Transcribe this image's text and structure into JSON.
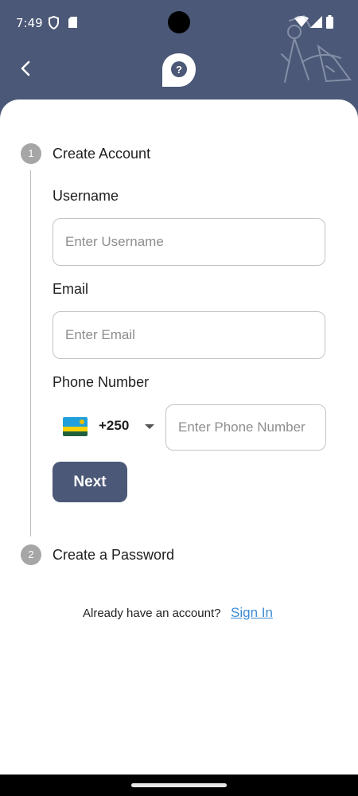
{
  "status_bar": {
    "time": "7:49"
  },
  "steps": [
    {
      "number": "1",
      "title": "Create Account"
    },
    {
      "number": "2",
      "title": "Create a Password"
    }
  ],
  "form": {
    "username": {
      "label": "Username",
      "placeholder": "Enter Username",
      "value": ""
    },
    "email": {
      "label": "Email",
      "placeholder": "Enter Email",
      "value": ""
    },
    "phone": {
      "label": "Phone Number",
      "country_code": "+250",
      "placeholder": "Enter Phone Number",
      "value": ""
    },
    "next_label": "Next"
  },
  "footer": {
    "prompt": "Already have an account?",
    "link": "Sign In"
  },
  "colors": {
    "header": "#4b5877",
    "button": "#4b5877",
    "link": "#3d8bd3",
    "step_circle": "#a6a6a6"
  },
  "icons": [
    "shield-icon",
    "sd-card-icon",
    "wifi-icon",
    "signal-icon",
    "battery-icon",
    "back-arrow-icon",
    "app-logo-icon",
    "compass-decoration-icon",
    "rwanda-flag-icon",
    "caret-down-icon"
  ]
}
